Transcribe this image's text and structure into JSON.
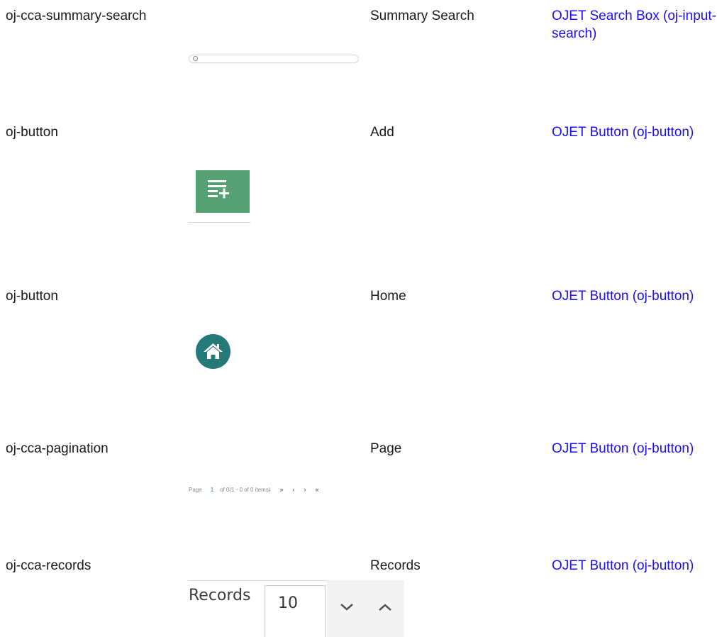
{
  "rows": [
    {
      "name": "oj-cca-summary-search",
      "label": "Summary Search",
      "link": "OJET Search Box (oj-input-search)"
    },
    {
      "name": "oj-button",
      "label": "Add",
      "link": "OJET Button (oj-button)"
    },
    {
      "name": "oj-button",
      "label": "Home",
      "link": "OJET Button (oj-button)"
    },
    {
      "name": "oj-cca-pagination",
      "label": "Page",
      "link": "OJET Button (oj-button)"
    },
    {
      "name": "oj-cca-records",
      "label": "Records",
      "link": "OJET Button (oj-button)"
    }
  ],
  "pagination": {
    "page_label": "Page",
    "page_number": "1",
    "of_label": "of",
    "total_pages": "0",
    "items_text": "(1 - 0 of 0 items)",
    "first": "»",
    "prev": "‹",
    "next": "›",
    "last": "«"
  },
  "records": {
    "label": "Records",
    "value": "10"
  },
  "icons": {
    "search": "search-icon",
    "add": "add-list-icon",
    "home": "home-icon",
    "down": "chevron-down-icon",
    "up": "chevron-up-icon"
  },
  "colors": {
    "link": "#1a0dff",
    "add_button": "#56a173",
    "home_button": "#237a79"
  }
}
